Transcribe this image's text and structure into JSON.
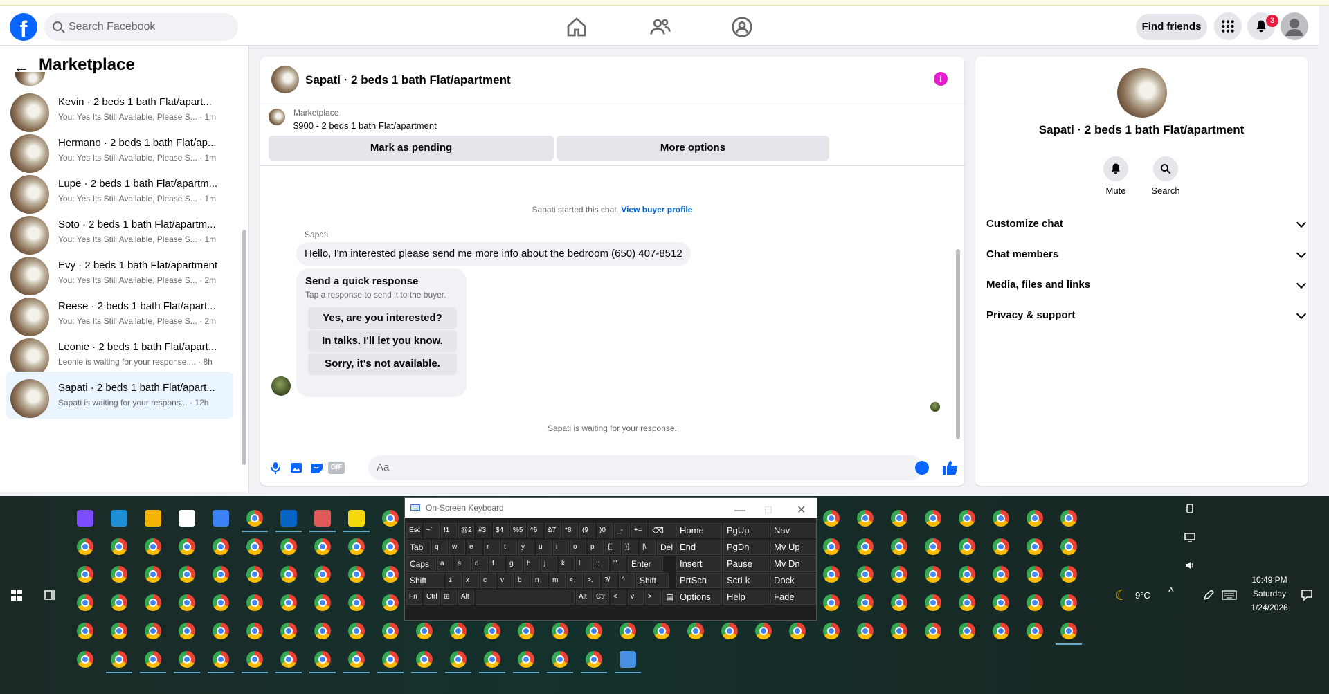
{
  "header": {
    "search_placeholder": "Search Facebook",
    "find_friends": "Find friends",
    "notif_count": "3"
  },
  "left_pane": {
    "title": "Marketplace",
    "conversations": [
      {
        "name": "Kevin · 2 beds 1 bath Flat/apart...",
        "preview": "You: Yes Its Still Available, Please S... · 1m"
      },
      {
        "name": "Hermano · 2 beds 1 bath Flat/ap...",
        "preview": "You: Yes Its Still Available, Please S... · 1m"
      },
      {
        "name": "Lupe · 2 beds 1 bath Flat/apartm...",
        "preview": "You: Yes Its Still Available, Please S... · 1m"
      },
      {
        "name": "Soto · 2 beds 1 bath Flat/apartm...",
        "preview": "You: Yes Its Still Available, Please S... · 1m"
      },
      {
        "name": "Evy · 2 beds 1 bath Flat/apartment",
        "preview": "You: Yes Its Still Available, Please S... · 2m"
      },
      {
        "name": "Reese · 2 beds 1 bath Flat/apart...",
        "preview": "You: Yes Its Still Available, Please S... · 2m"
      },
      {
        "name": "Leonie · 2 beds 1 bath Flat/apart...",
        "preview": "Leonie is waiting for your response.... · 8h"
      },
      {
        "name": "Sapati · 2 beds 1 bath Flat/apart...",
        "preview": "Sapati is waiting for your respons... · 12h"
      }
    ]
  },
  "chat": {
    "title": "Sapati · 2 beds 1 bath Flat/apartment",
    "listing_label": "Marketplace",
    "listing_price": "$900 - 2 beds 1 bath Flat/apartment",
    "mark_pending": "Mark as pending",
    "more_options": "More options",
    "started_text": "Sapati started this chat.",
    "view_buyer": "View buyer profile",
    "sender": "Sapati",
    "message": "Hello, I'm interested please send me more info about the bedroom (650) 407-8512",
    "quick_title": "Send a quick response",
    "quick_sub": "Tap a response to send it to the buyer.",
    "quick_options": [
      "Yes, are you interested?",
      "In talks. I'll let you know.",
      "Sorry, it's not available."
    ],
    "waiting": "Sapati is waiting for your response.",
    "input_placeholder": "Aa",
    "gif": "GIF"
  },
  "right_pane": {
    "title": "Sapati · 2 beds 1 bath Flat/apartment",
    "mute": "Mute",
    "search": "Search",
    "sections": [
      "Customize chat",
      "Chat members",
      "Media, files and links",
      "Privacy & support"
    ]
  },
  "keyboard": {
    "title": "On-Screen Keyboard",
    "rows": [
      [
        "Esc",
        "~`",
        "!1",
        "@2",
        "#3",
        "$4",
        "%5",
        "^6",
        "&7",
        "*8",
        "(9",
        ")0",
        "_-",
        "+=",
        "⌫"
      ],
      [
        "Tab",
        "q",
        "w",
        "e",
        "r",
        "t",
        "y",
        "u",
        "i",
        "o",
        "p",
        "{[",
        "}]",
        "|\\",
        "Del"
      ],
      [
        "Caps",
        "a",
        "s",
        "d",
        "f",
        "g",
        "h",
        "j",
        "k",
        "l",
        ":;",
        "\"'",
        "Enter"
      ],
      [
        "Shift",
        "z",
        "x",
        "c",
        "v",
        "b",
        "n",
        "m",
        "<,",
        ">.",
        "?/",
        "^",
        "Shift"
      ],
      [
        "Fn",
        "Ctrl",
        "⊞",
        "Alt",
        "",
        "Alt",
        "Ctrl",
        "<",
        "v",
        ">",
        "▤"
      ]
    ],
    "nav_keys": [
      [
        "Home",
        "PgUp",
        "Nav"
      ],
      [
        "End",
        "PgDn",
        "Mv Up"
      ],
      [
        "Insert",
        "Pause",
        "Mv Dn"
      ],
      [
        "PrtScn",
        "ScrLk",
        "Dock"
      ],
      [
        "Options",
        "Help",
        "Fade"
      ]
    ]
  },
  "tray": {
    "weather": "9°C",
    "time": "10:49 PM",
    "day": "Saturday",
    "date": "1/24/2026"
  },
  "colors": {
    "accent": "#0866ff",
    "badge": "#e41e3f",
    "info": "#e41ecc"
  }
}
